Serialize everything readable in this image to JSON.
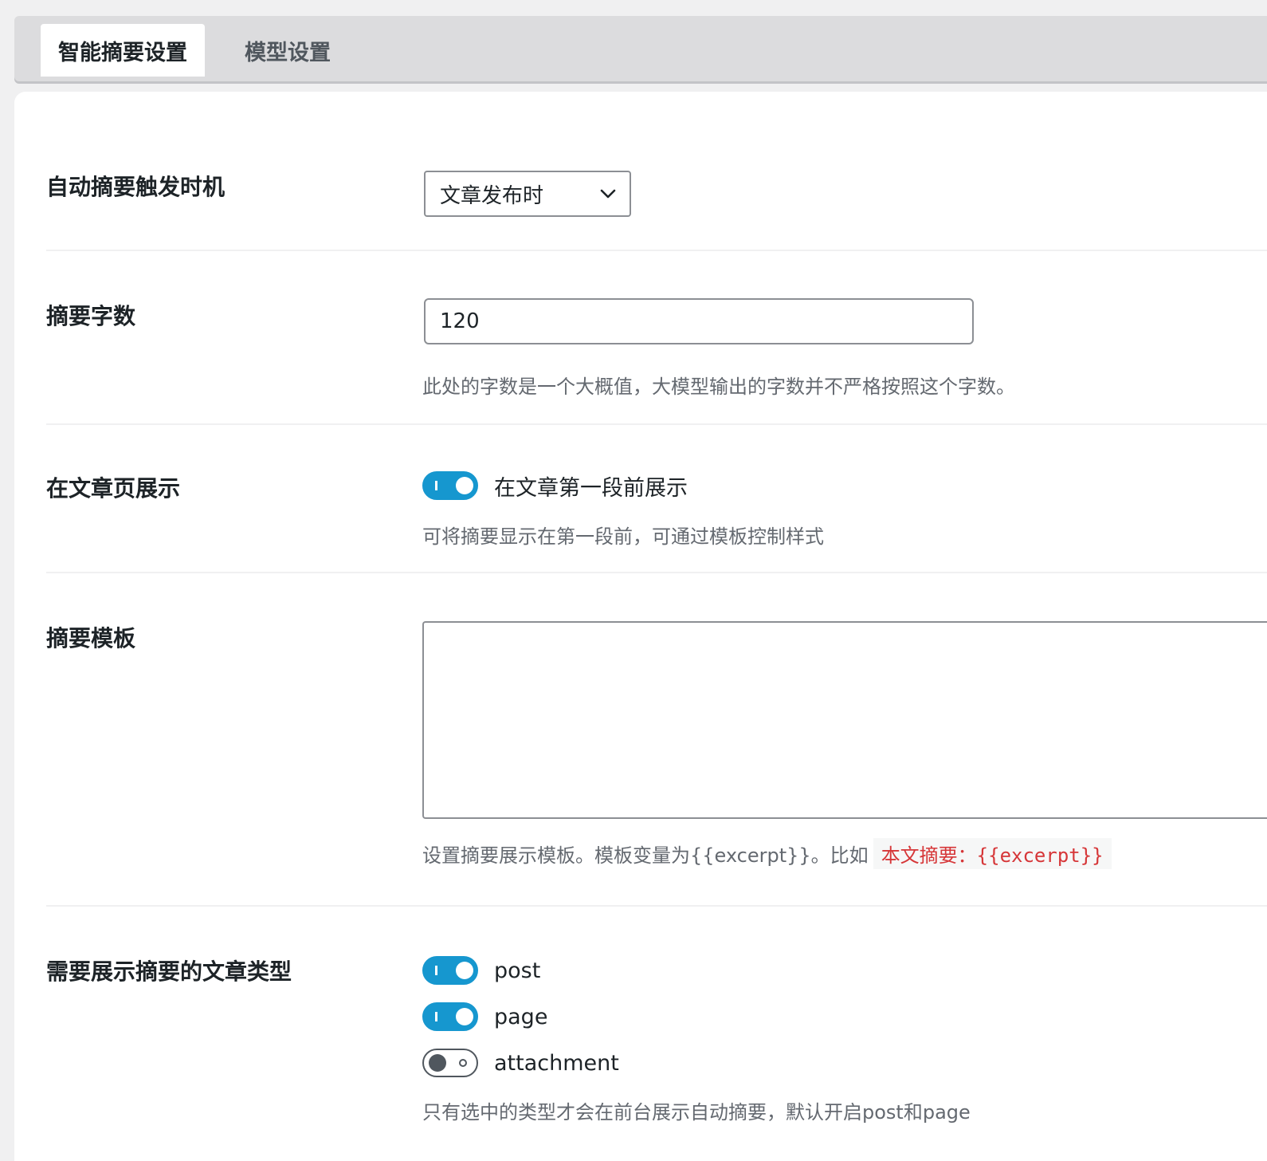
{
  "tabs": [
    {
      "label": "智能摘要设置",
      "active": true
    },
    {
      "label": "模型设置",
      "active": false
    }
  ],
  "trigger": {
    "label": "自动摘要触发时机",
    "selected": "文章发布时"
  },
  "length": {
    "label": "摘要字数",
    "value": "120",
    "description": "此处的字数是一个大概值，大模型输出的字数并不严格按照这个字数。"
  },
  "display": {
    "label": "在文章页展示",
    "toggle_label": "在文章第一段前展示",
    "toggle_on": true,
    "description": "可将摘要显示在第一段前，可通过模板控制样式"
  },
  "template": {
    "label": "摘要模板",
    "value": "",
    "description": "设置摘要展示模板。模板变量为{{excerpt}}。比如",
    "example": "本文摘要：{{excerpt}}"
  },
  "post_types": {
    "label": "需要展示摘要的文章类型",
    "items": [
      {
        "label": "post",
        "on": true
      },
      {
        "label": "page",
        "on": true
      },
      {
        "label": "attachment",
        "on": false
      }
    ],
    "description": "只有选中的类型才会在前台展示自动摘要，默认开启post和page"
  },
  "colors": {
    "accent": "#1697cf",
    "code_text": "#d63638",
    "muted_text": "#646970"
  }
}
